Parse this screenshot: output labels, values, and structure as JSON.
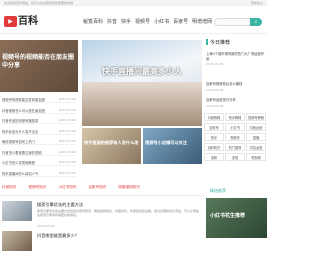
{
  "topbar": {
    "left": "欢迎来到百科网站，您可以在这里找到您想要的内容",
    "right": "帮助中心"
  },
  "header": {
    "logo_icon": "play-icon",
    "logo_text": "百科",
    "nav": [
      "秘笈百科",
      "抖音",
      "快手",
      "视频号",
      "小红书",
      "百家号",
      "明增增网"
    ],
    "search_icon": "search-icon"
  },
  "left": {
    "hero_title": "视频号的视频能否在朋友圈中分享",
    "items": [
      {
        "title": "视频号的视频能否发到朋友圈",
        "date": "2023-05-06"
      },
      {
        "title": "抖音视频怎么可以放在朋友圈",
        "date": "2023-05-06"
      },
      {
        "title": "抖音作品如何做有播放量",
        "date": "2023-05-06"
      },
      {
        "title": "快手私信为什么发不出去",
        "date": "2023-05-06"
      },
      {
        "title": "微信视频号如何上热门",
        "date": "2023-05-06"
      },
      {
        "title": "抖音怎么看谁看过我的视频",
        "date": "2023-05-06"
      },
      {
        "title": "小红书怎么发视频教程",
        "date": "2023-05-06"
      },
      {
        "title": "快手直播间怎么增加人气",
        "date": "2023-05-06"
      },
      {
        "title": "百家号收益怎么提现",
        "date": "2023-05-06"
      }
    ]
  },
  "center": {
    "hero_title": "快手直播间最高多少人",
    "thumb1_title": "快手里面的推荐有人发什么用",
    "thumb2_title": "视频号小店铺可以关注"
  },
  "side": {
    "head": "今日推荐",
    "articles": [
      {
        "title": "上海5个城市现有新的热门大厂商运营作品",
        "date": "2023-05-06"
      },
      {
        "title": "百家号视频背后怎么赚钱",
        "date": "2023-05-06"
      },
      {
        "title": "百家号运营技巧分享",
        "date": "2023-05-06"
      }
    ],
    "tags": [
      [
        "抖音教程",
        "快手教程",
        "视频号教程"
      ],
      [
        "百家号",
        "小红书",
        "抖音运营"
      ],
      [
        "快手",
        "视频号",
        "直播"
      ],
      [
        "百科知识",
        "热门推荐",
        "内容运营"
      ],
      [
        "涨粉",
        "变现",
        "短视频"
      ]
    ]
  },
  "tabs": [
    "抖音知识",
    "视频号知识",
    "小红书知识",
    "百家号知识",
    "明增增网知识"
  ],
  "feed": [
    {
      "title": "搜索引擎优化的主要方法",
      "desc": "搜索引擎优化的主要方法包括关键词研究、网站结构优化、内容优化、外部链接建设等。通过合理的优化手段，可以让网站在搜索引擎中获得更好的排名。",
      "meta": "2023-05-06"
    },
    {
      "title": "抖音哪里能是最多少？",
      "desc": "",
      "meta": ""
    }
  ],
  "promo": {
    "head": "精选推荐",
    "title": "小红书花生推荐"
  }
}
